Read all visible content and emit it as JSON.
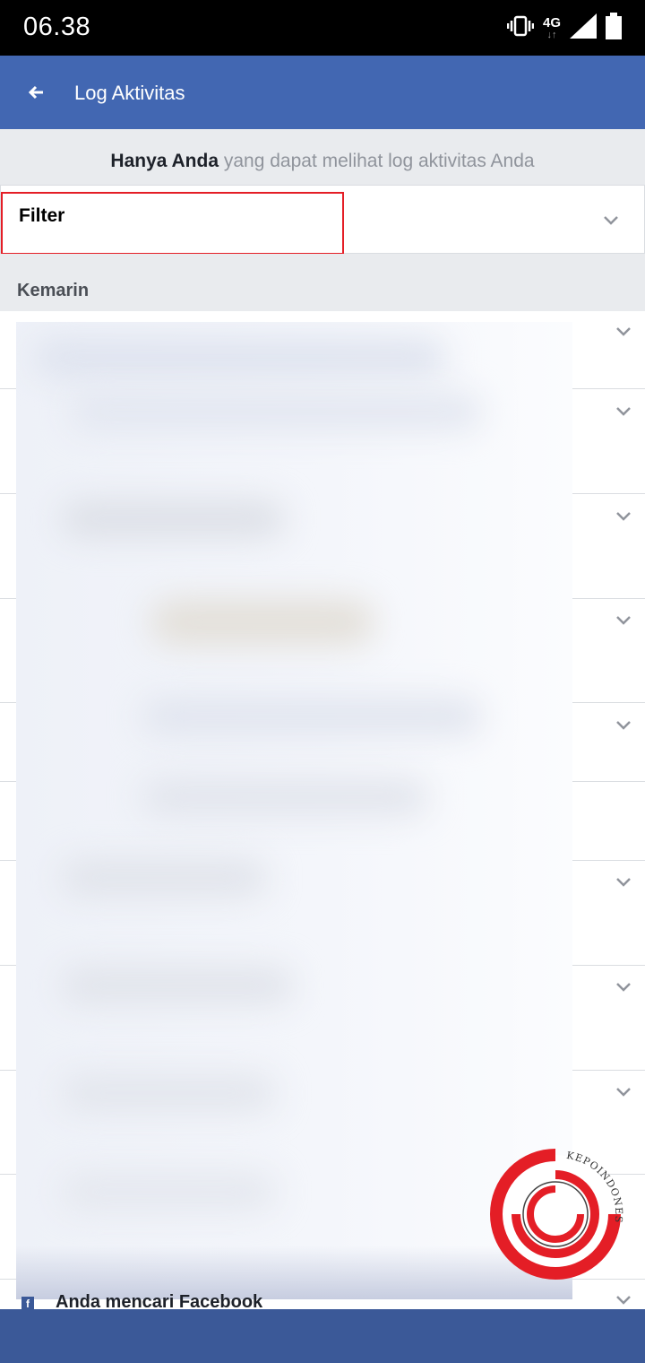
{
  "status_bar": {
    "time": "06.38",
    "network_label": "4G",
    "icons": [
      "vibrate-icon",
      "network-arrows-icon",
      "signal-icon",
      "battery-icon"
    ]
  },
  "app_bar": {
    "title": "Log Aktivitas",
    "back_icon": "back-arrow-icon",
    "color": "#4267b2"
  },
  "privacy_notice": {
    "bold": "Hanya Anda",
    "rest": " yang dapat melihat log aktivitas Anda"
  },
  "filter": {
    "label": "Filter",
    "highlight_color": "#e41e26"
  },
  "section": {
    "label": "Kemarin"
  },
  "list": {
    "last_item_text": "Anda mencari Facebook"
  },
  "watermark": {
    "text": "KEPOINDONESIA",
    "color": "#e41e26"
  },
  "colors": {
    "nav_bar": "#3b5998",
    "section_bg": "#e9ebee"
  }
}
